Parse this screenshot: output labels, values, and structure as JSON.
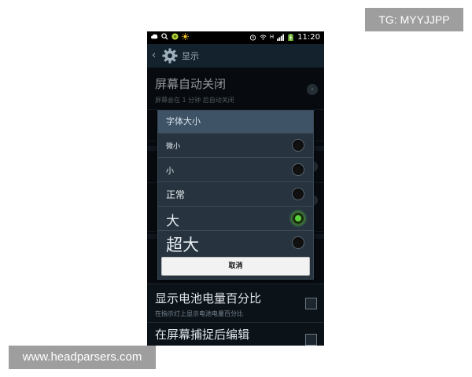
{
  "watermarks": {
    "top": "TG: MYYJJPP",
    "bottom": "www.headparsers.com"
  },
  "status_bar": {
    "time": "11:20",
    "left_icons": [
      "cloud-icon",
      "search-icon",
      "app-icon",
      "sun-icon"
    ],
    "right_icons": [
      "alarm-icon",
      "wifi-icon",
      "h-network-icon",
      "signal-icon",
      "battery-icon"
    ],
    "network_label": "H"
  },
  "action_bar": {
    "back_glyph": "‹",
    "title": "显示"
  },
  "settings": [
    {
      "title": "屏幕自动关闭",
      "subtitle": "屏幕会在 1 分钟 后自动关闭",
      "control": "arrow"
    },
    {
      "title": "显示电池电量百分比",
      "subtitle": "在指示灯上显示电池电量百分比",
      "control": "checkbox"
    },
    {
      "title": "在屏幕捕捉后编辑",
      "subtitle": "",
      "control": "checkbox"
    }
  ],
  "dialog": {
    "title": "字体大小",
    "options": [
      {
        "label": "微小",
        "selected": false
      },
      {
        "label": "小",
        "selected": false
      },
      {
        "label": "正常",
        "selected": false
      },
      {
        "label": "大",
        "selected": true
      },
      {
        "label": "超大",
        "selected": false
      }
    ],
    "cancel_label": "取消"
  },
  "colors": {
    "selected_radio": "#57d23a",
    "dialog_title_bg": "#3e5366",
    "screen_bg": "#0b1218"
  }
}
